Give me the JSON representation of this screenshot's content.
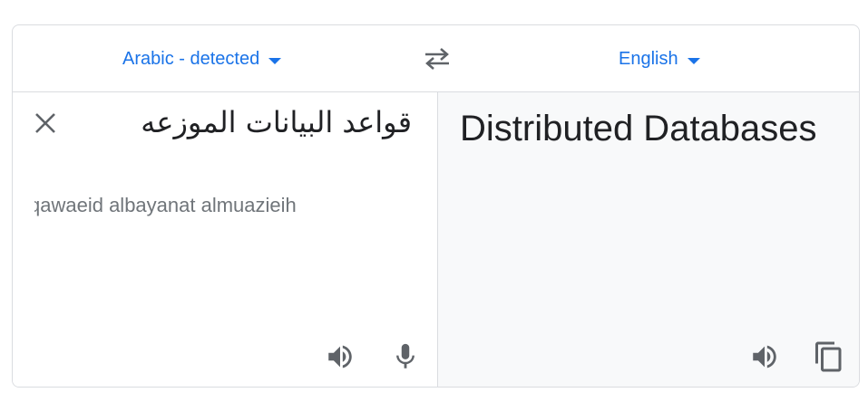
{
  "header": {
    "source_language": "Arabic - detected",
    "target_language": "English",
    "swap_icon": "swap-arrows-icon"
  },
  "source": {
    "text": "قواعد البيانات الموزعه",
    "transliteration": "qawaeid albayanat almuazieih",
    "icons": [
      "close-icon",
      "speaker-icon",
      "microphone-icon"
    ]
  },
  "target": {
    "text": "Distributed Databases",
    "icons": [
      "speaker-icon",
      "copy-icon"
    ]
  },
  "colors": {
    "accent": "#1a73e8",
    "text": "#202124",
    "muted": "#70757a",
    "icon": "#5f6368",
    "border": "#dadce0",
    "result_bg": "#f8f9fa"
  }
}
